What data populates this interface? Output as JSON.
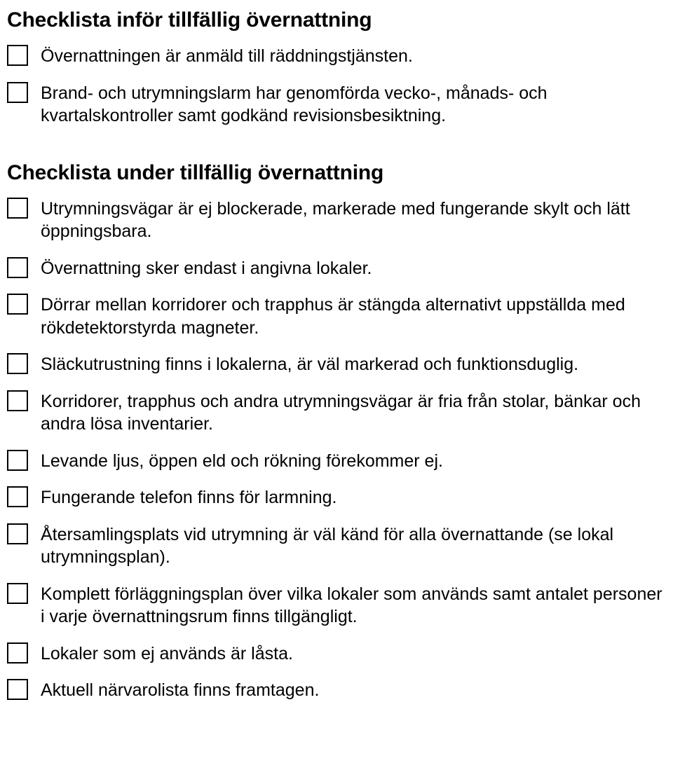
{
  "sections": [
    {
      "heading": "Checklista inför tillfällig övernattning",
      "items": [
        "Övernattningen är anmäld till räddningstjänsten.",
        "Brand- och utrymningslarm har genomförda vecko-, månads- och kvartalskontroller samt godkänd revisionsbesiktning."
      ]
    },
    {
      "heading": "Checklista under tillfällig övernattning",
      "items": [
        "Utrymningsvägar är ej blockerade, markerade med fungerande skylt och lätt öppningsbara.",
        "Övernattning sker endast i angivna lokaler.",
        "Dörrar mellan korridorer och trapphus är stängda alternativt uppställda med rökdetektorstyrda magneter.",
        "Släckutrustning finns i lokalerna, är väl markerad och funktionsduglig.",
        "Korridorer, trapphus och andra utrymningsvägar är fria från stolar, bänkar och andra lösa inventarier.",
        "Levande ljus, öppen eld och rökning förekommer ej.",
        "Fungerande telefon finns för larmning.",
        "Återsamlingsplats vid utrymning är väl känd för alla övernattande (se lokal utrymningsplan).",
        "Komplett förläggningsplan över vilka lokaler som används samt antalet personer i varje övernattningsrum finns tillgängligt.",
        "Lokaler som ej används är låsta.",
        "Aktuell närvarolista finns framtagen."
      ]
    }
  ]
}
